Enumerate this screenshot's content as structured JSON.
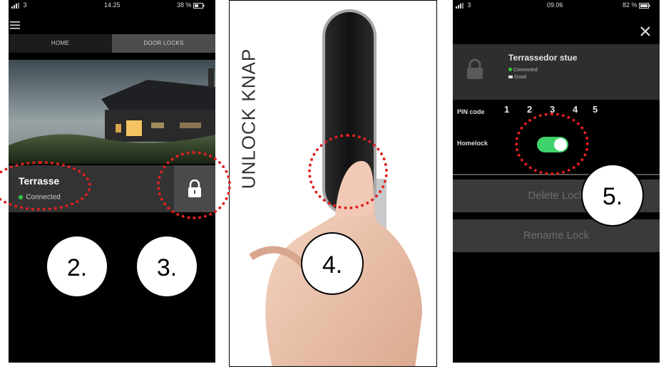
{
  "panel1": {
    "status_left": "3",
    "status_time": "14.25",
    "status_right": "38 %",
    "tabs": [
      {
        "label": "HOME"
      },
      {
        "label": "DOOR LOCKS"
      }
    ],
    "lock": {
      "name": "Terrasse",
      "status": "Connected"
    },
    "callouts": [
      {
        "label": "2."
      },
      {
        "label": "3."
      }
    ]
  },
  "panel2": {
    "vertical_text": "UNLOCK KNAP",
    "callout": "4."
  },
  "panel3": {
    "status_left": "3",
    "status_time": "09.06",
    "status_right": "82 %",
    "lock_name": "Terrassedor stue",
    "conn_status": "Connected",
    "battery_status": "Good",
    "pin_label": "PIN code",
    "pin_digits": [
      "1",
      "2",
      "3",
      "4",
      "5"
    ],
    "homelock_label": "Homelock",
    "homelock_on": true,
    "delete_label": "Delete Lock",
    "rename_label": "Rename Lock",
    "callout": "5."
  },
  "colors": {
    "connected": "#2ecc40",
    "toggle_on": "#3fd16a",
    "callout_dots": "#e02020"
  }
}
